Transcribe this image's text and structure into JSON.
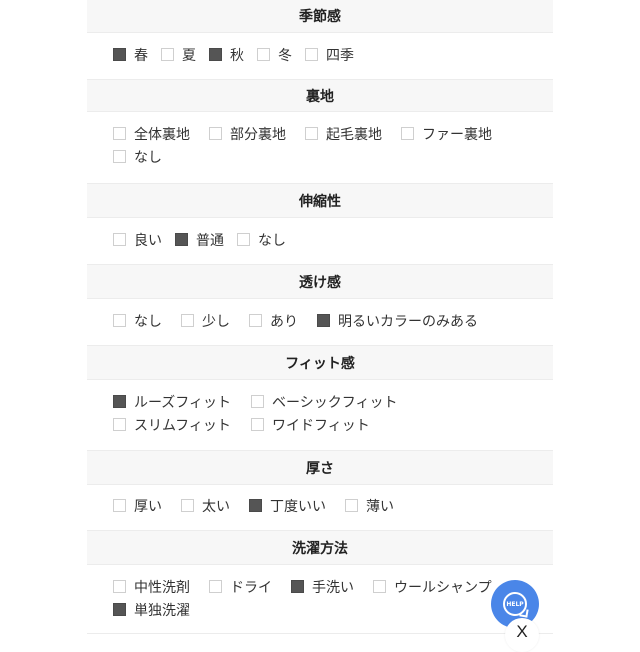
{
  "colors": {
    "header_bg": "#f7f7f7",
    "checked": "#555555",
    "unchecked_border": "#cfcfcf",
    "help_button": "#4a86e8"
  },
  "sections": [
    {
      "title": "季節感",
      "options": [
        {
          "label": "春",
          "checked": true
        },
        {
          "label": "夏",
          "checked": false
        },
        {
          "label": "秋",
          "checked": true
        },
        {
          "label": "冬",
          "checked": false
        },
        {
          "label": "四季",
          "checked": false
        }
      ]
    },
    {
      "title": "裏地",
      "options": [
        {
          "label": "全体裏地",
          "checked": false
        },
        {
          "label": "部分裏地",
          "checked": false
        },
        {
          "label": "起毛裏地",
          "checked": false
        },
        {
          "label": "ファー裏地",
          "checked": false
        },
        {
          "label": "なし",
          "checked": false
        }
      ]
    },
    {
      "title": "伸縮性",
      "options": [
        {
          "label": "良い",
          "checked": false
        },
        {
          "label": "普通",
          "checked": true
        },
        {
          "label": "なし",
          "checked": false
        }
      ]
    },
    {
      "title": "透け感",
      "options": [
        {
          "label": "なし",
          "checked": false
        },
        {
          "label": "少し",
          "checked": false
        },
        {
          "label": "あり",
          "checked": false
        },
        {
          "label": "明るいカラーのみある",
          "checked": true
        }
      ]
    },
    {
      "title": "フィット感",
      "options": [
        {
          "label": "ルーズフィット",
          "checked": true
        },
        {
          "label": "ベーシックフィット",
          "checked": false
        },
        {
          "label": "スリムフィット",
          "checked": false
        },
        {
          "label": "ワイドフィット",
          "checked": false
        }
      ]
    },
    {
      "title": "厚さ",
      "options": [
        {
          "label": "厚い",
          "checked": false
        },
        {
          "label": "太い",
          "checked": false
        },
        {
          "label": "丁度いい",
          "checked": true
        },
        {
          "label": "薄い",
          "checked": false
        }
      ]
    },
    {
      "title": "洗濯方法",
      "options": [
        {
          "label": "中性洗剤",
          "checked": false
        },
        {
          "label": "ドライ",
          "checked": false
        },
        {
          "label": "手洗い",
          "checked": true
        },
        {
          "label": "ウールシャンプ",
          "checked": false
        },
        {
          "label": "単独洗濯",
          "checked": true
        }
      ]
    }
  ],
  "help_button": {
    "label": "HELP",
    "icon": "help-bubble-icon"
  },
  "close_button": {
    "label": "X",
    "icon": "close-icon"
  }
}
